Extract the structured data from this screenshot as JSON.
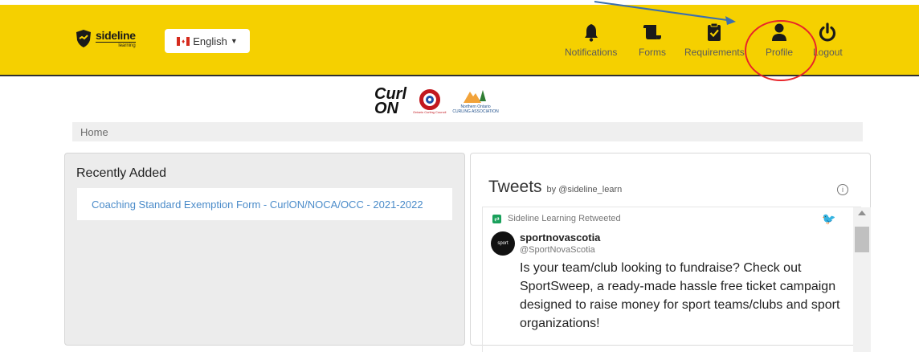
{
  "brand": {
    "name": "sideline",
    "tagline": "learning"
  },
  "language": {
    "label": "English"
  },
  "nav": {
    "notifications": "Notifications",
    "forms": "Forms",
    "requirements": "Requirements",
    "profile": "Profile",
    "logout": "Logout"
  },
  "partners": {
    "curlon": {
      "line1": "Curl",
      "line2": "ON"
    },
    "occ": "Ontario Curling Council",
    "noca": {
      "name": "Northern Ontario",
      "sub": "CURLING ASSOCIATION"
    }
  },
  "breadcrumb": {
    "home": "Home"
  },
  "recent": {
    "title": "Recently Added",
    "items": [
      "Coaching Standard Exemption Form - CurlON/NOCA/OCC - 2021-2022"
    ]
  },
  "tweets": {
    "title": "Tweets",
    "by": "by @sideline_learn",
    "retweet_label": "Sideline Learning Retweeted",
    "author_name": "sportnovascotia",
    "author_handle": "@SportNovaScotia",
    "text": "Is your team/club looking to fundraise? Check out SportSweep, a ready-made hassle free ticket campaign designed to raise money for sport teams/clubs and sport organizations!",
    "avatar_text": "sport"
  },
  "colors": {
    "navbar": "#f5d000",
    "annotation_circle": "#e8242a",
    "annotation_arrow": "#3a6fb0",
    "link": "#4a8bc9"
  }
}
